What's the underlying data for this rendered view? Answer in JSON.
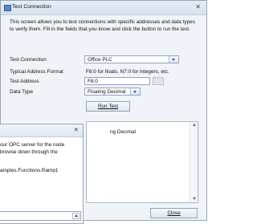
{
  "window": {
    "title": "Test Connection",
    "close_glyph": "✕"
  },
  "intro_text": "This screen allows you to test connections with specific addresses and data types to verify them. Fill in the fields that you know and click the button to run the test.",
  "fields": {
    "test_connection": {
      "label": "Test Connection",
      "value": "Office PLC"
    },
    "address_format": {
      "label": "Typical Address Format",
      "value": "F8:0 for floats, N7:0 for integers, etc."
    },
    "test_address": {
      "label": "Test Address",
      "value": "F8:0"
    },
    "data_type": {
      "label": "Data Type",
      "value": "Floating Decimal"
    }
  },
  "run_test_label": "Run Test",
  "results_text": "ng Decimal",
  "close_label": "Close",
  "sub_dialog": {
    "close_glyph": "✕",
    "text_line1": "our OPC server for the node",
    "text_line2": "browse down through the",
    "node_path": "amples.Functions.Ramp1"
  },
  "icons": {
    "title_icon": "connection-window-icon",
    "dropdown_arrow": "chevron-down-icon",
    "scroll_up": "scroll-up-icon",
    "scroll_down": "scroll-down-icon"
  }
}
